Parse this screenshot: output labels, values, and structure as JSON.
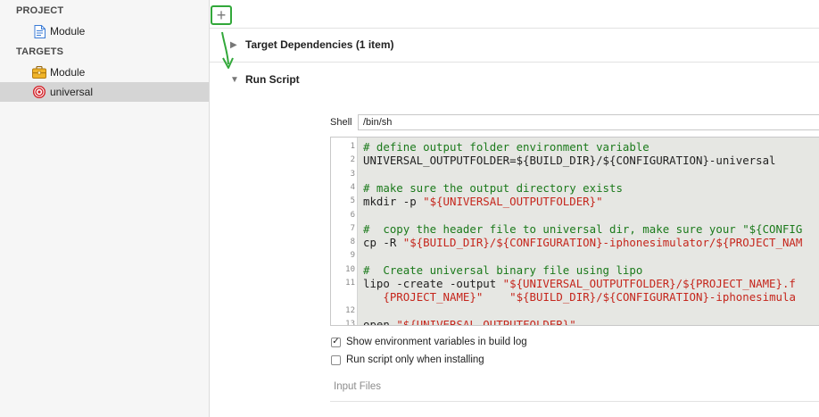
{
  "sidebar": {
    "project_header": "PROJECT",
    "project_items": [
      {
        "label": "Module",
        "icon": "project-file-icon"
      }
    ],
    "targets_header": "TARGETS",
    "target_items": [
      {
        "label": "Module",
        "icon": "framework-toolbox-icon"
      },
      {
        "label": "universal",
        "icon": "aggregate-target-icon",
        "selected": true
      }
    ]
  },
  "toolbar": {
    "add_label": "+"
  },
  "phases": {
    "target_dependencies": {
      "title": "Target Dependencies (1 item)",
      "expanded": false
    },
    "run_script": {
      "title": "Run Script",
      "expanded": true
    }
  },
  "run_script": {
    "shell_label": "Shell",
    "shell_value": "/bin/sh",
    "lines": [
      {
        "n": "1",
        "parts": [
          {
            "c": "cmt",
            "t": "# define output folder environment variable"
          }
        ]
      },
      {
        "n": "2",
        "parts": [
          {
            "c": "txt",
            "t": "UNIVERSAL_OUTPUTFOLDER=${BUILD_DIR}/${CONFIGURATION}-universal"
          }
        ]
      },
      {
        "n": "3",
        "parts": []
      },
      {
        "n": "4",
        "parts": [
          {
            "c": "cmt",
            "t": "# make sure the output directory exists"
          }
        ]
      },
      {
        "n": "5",
        "parts": [
          {
            "c": "txt",
            "t": "mkdir -p "
          },
          {
            "c": "str",
            "t": "\"${UNIVERSAL_OUTPUTFOLDER}\""
          }
        ]
      },
      {
        "n": "6",
        "parts": []
      },
      {
        "n": "7",
        "parts": [
          {
            "c": "cmt",
            "t": "#  copy the header file to universal dir, make sure your \"${CONFIG"
          }
        ]
      },
      {
        "n": "8",
        "parts": [
          {
            "c": "txt",
            "t": "cp -R "
          },
          {
            "c": "str",
            "t": "\"${BUILD_DIR}/${CONFIGURATION}-iphonesimulator/${PROJECT_NAM"
          }
        ]
      },
      {
        "n": "9",
        "parts": []
      },
      {
        "n": "10",
        "parts": [
          {
            "c": "cmt",
            "t": "#  Create universal binary file using lipo"
          }
        ]
      },
      {
        "n": "11",
        "parts": [
          {
            "c": "txt",
            "t": "lipo -create -output "
          },
          {
            "c": "str",
            "t": "\"${UNIVERSAL_OUTPUTFOLDER}/${PROJECT_NAME}.f"
          }
        ]
      },
      {
        "n": "",
        "parts": [
          {
            "c": "txt",
            "t": "   "
          },
          {
            "c": "str",
            "t": "{PROJECT_NAME}\""
          },
          {
            "c": "txt",
            "t": "    "
          },
          {
            "c": "str",
            "t": "\"${BUILD_DIR}/${CONFIGURATION}-iphonesimula"
          }
        ]
      },
      {
        "n": "12",
        "parts": []
      },
      {
        "n": "13",
        "parts": [
          {
            "c": "txt",
            "t": "open "
          },
          {
            "c": "str",
            "t": "\"${UNIVERSAL_OUTPUTFOLDER}\""
          }
        ]
      }
    ],
    "show_env_label": "Show environment variables in build log",
    "show_env_checked": true,
    "only_installing_label": "Run script only when installing",
    "only_installing_checked": false,
    "input_files_label": "Input Files"
  },
  "colors": {
    "annotation": "#32a83a",
    "comment": "#1b7a1b",
    "string": "#c5261c"
  }
}
